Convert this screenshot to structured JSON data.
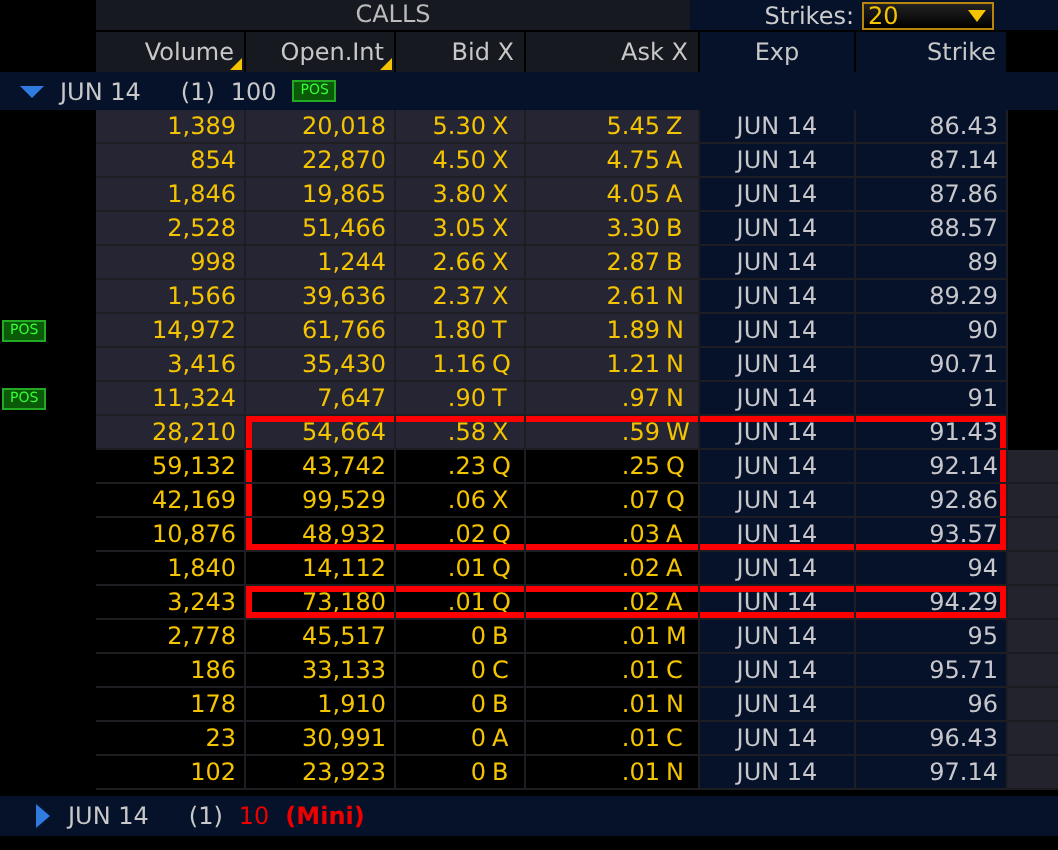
{
  "header": {
    "title": "CALLS",
    "strikes_label": "Strikes:",
    "strikes_value": "20"
  },
  "columns": [
    {
      "label": "Volume",
      "sortable": true
    },
    {
      "label": "Open.Int",
      "sortable": true
    },
    {
      "label": "Bid X",
      "sortable": false
    },
    {
      "label": "Ask X",
      "sortable": false
    },
    {
      "label": "Exp",
      "sortable": false
    },
    {
      "label": "Strike",
      "sortable": false
    }
  ],
  "group": {
    "expanded": true,
    "label": "JUN 14",
    "count": "(1)",
    "multiplier": "100",
    "flag": "POS"
  },
  "rows": [
    {
      "volume": "1,389",
      "open_int": "20,018",
      "bid": "5.30",
      "bid_x": "X",
      "ask": "5.45",
      "ask_x": "Z",
      "exp": "JUN 14",
      "strike": "86.43",
      "itm": true,
      "boxed": false
    },
    {
      "volume": "854",
      "open_int": "22,870",
      "bid": "4.50",
      "bid_x": "X",
      "ask": "4.75",
      "ask_x": "A",
      "exp": "JUN 14",
      "strike": "87.14",
      "itm": true,
      "boxed": false
    },
    {
      "volume": "1,846",
      "open_int": "19,865",
      "bid": "3.80",
      "bid_x": "X",
      "ask": "4.05",
      "ask_x": "A",
      "exp": "JUN 14",
      "strike": "87.86",
      "itm": true,
      "boxed": false
    },
    {
      "volume": "2,528",
      "open_int": "51,466",
      "bid": "3.05",
      "bid_x": "X",
      "ask": "3.30",
      "ask_x": "B",
      "exp": "JUN 14",
      "strike": "88.57",
      "itm": true,
      "boxed": false
    },
    {
      "volume": "998",
      "open_int": "1,244",
      "bid": "2.66",
      "bid_x": "X",
      "ask": "2.87",
      "ask_x": "B",
      "exp": "JUN 14",
      "strike": "89",
      "itm": true,
      "boxed": false
    },
    {
      "volume": "1,566",
      "open_int": "39,636",
      "bid": "2.37",
      "bid_x": "X",
      "ask": "2.61",
      "ask_x": "N",
      "exp": "JUN 14",
      "strike": "89.29",
      "itm": true,
      "boxed": false
    },
    {
      "flag": "POS",
      "volume": "14,972",
      "open_int": "61,766",
      "bid": "1.80",
      "bid_x": "T",
      "ask": "1.89",
      "ask_x": "N",
      "exp": "JUN 14",
      "strike": "90",
      "itm": true,
      "boxed": false
    },
    {
      "volume": "3,416",
      "open_int": "35,430",
      "bid": "1.16",
      "bid_x": "Q",
      "ask": "1.21",
      "ask_x": "N",
      "exp": "JUN 14",
      "strike": "90.71",
      "itm": true,
      "boxed": false
    },
    {
      "flag": "POS",
      "volume": "11,324",
      "open_int": "7,647",
      "bid": ".90",
      "bid_x": "T",
      "ask": ".97",
      "ask_x": "N",
      "exp": "JUN 14",
      "strike": "91",
      "itm": true,
      "boxed": false
    },
    {
      "volume": "28,210",
      "open_int": "54,664",
      "bid": ".58",
      "bid_x": "X",
      "ask": ".59",
      "ask_x": "W",
      "exp": "JUN 14",
      "strike": "91.43",
      "itm": true,
      "boxed": true
    },
    {
      "volume": "59,132",
      "open_int": "43,742",
      "bid": ".23",
      "bid_x": "Q",
      "ask": ".25",
      "ask_x": "Q",
      "exp": "JUN 14",
      "strike": "92.14",
      "itm": false,
      "boxed": true
    },
    {
      "volume": "42,169",
      "open_int": "99,529",
      "bid": ".06",
      "bid_x": "X",
      "ask": ".07",
      "ask_x": "Q",
      "exp": "JUN 14",
      "strike": "92.86",
      "itm": false,
      "boxed": true
    },
    {
      "volume": "10,876",
      "open_int": "48,932",
      "bid": ".02",
      "bid_x": "Q",
      "ask": ".03",
      "ask_x": "A",
      "exp": "JUN 14",
      "strike": "93.57",
      "itm": false,
      "boxed": true
    },
    {
      "volume": "1,840",
      "open_int": "14,112",
      "bid": ".01",
      "bid_x": "Q",
      "ask": ".02",
      "ask_x": "A",
      "exp": "JUN 14",
      "strike": "94",
      "itm": false,
      "boxed": false
    },
    {
      "volume": "3,243",
      "open_int": "73,180",
      "bid": ".01",
      "bid_x": "Q",
      "ask": ".02",
      "ask_x": "A",
      "exp": "JUN 14",
      "strike": "94.29",
      "itm": false,
      "boxed": true
    },
    {
      "volume": "2,778",
      "open_int": "45,517",
      "bid": "0",
      "bid_x": "B",
      "ask": ".01",
      "ask_x": "M",
      "exp": "JUN 14",
      "strike": "95",
      "itm": false,
      "boxed": false
    },
    {
      "volume": "186",
      "open_int": "33,133",
      "bid": "0",
      "bid_x": "C",
      "ask": ".01",
      "ask_x": "C",
      "exp": "JUN 14",
      "strike": "95.71",
      "itm": false,
      "boxed": false
    },
    {
      "volume": "178",
      "open_int": "1,910",
      "bid": "0",
      "bid_x": "B",
      "ask": ".01",
      "ask_x": "N",
      "exp": "JUN 14",
      "strike": "96",
      "itm": false,
      "boxed": false
    },
    {
      "volume": "23",
      "open_int": "30,991",
      "bid": "0",
      "bid_x": "A",
      "ask": ".01",
      "ask_x": "C",
      "exp": "JUN 14",
      "strike": "96.43",
      "itm": false,
      "boxed": false
    },
    {
      "volume": "102",
      "open_int": "23,923",
      "bid": "0",
      "bid_x": "B",
      "ask": ".01",
      "ask_x": "N",
      "exp": "JUN 14",
      "strike": "97.14",
      "itm": false,
      "boxed": false
    }
  ],
  "next_group": {
    "expanded": false,
    "label": "JUN 14",
    "count": "(1)",
    "multiplier": "10",
    "note": "(Mini)"
  }
}
